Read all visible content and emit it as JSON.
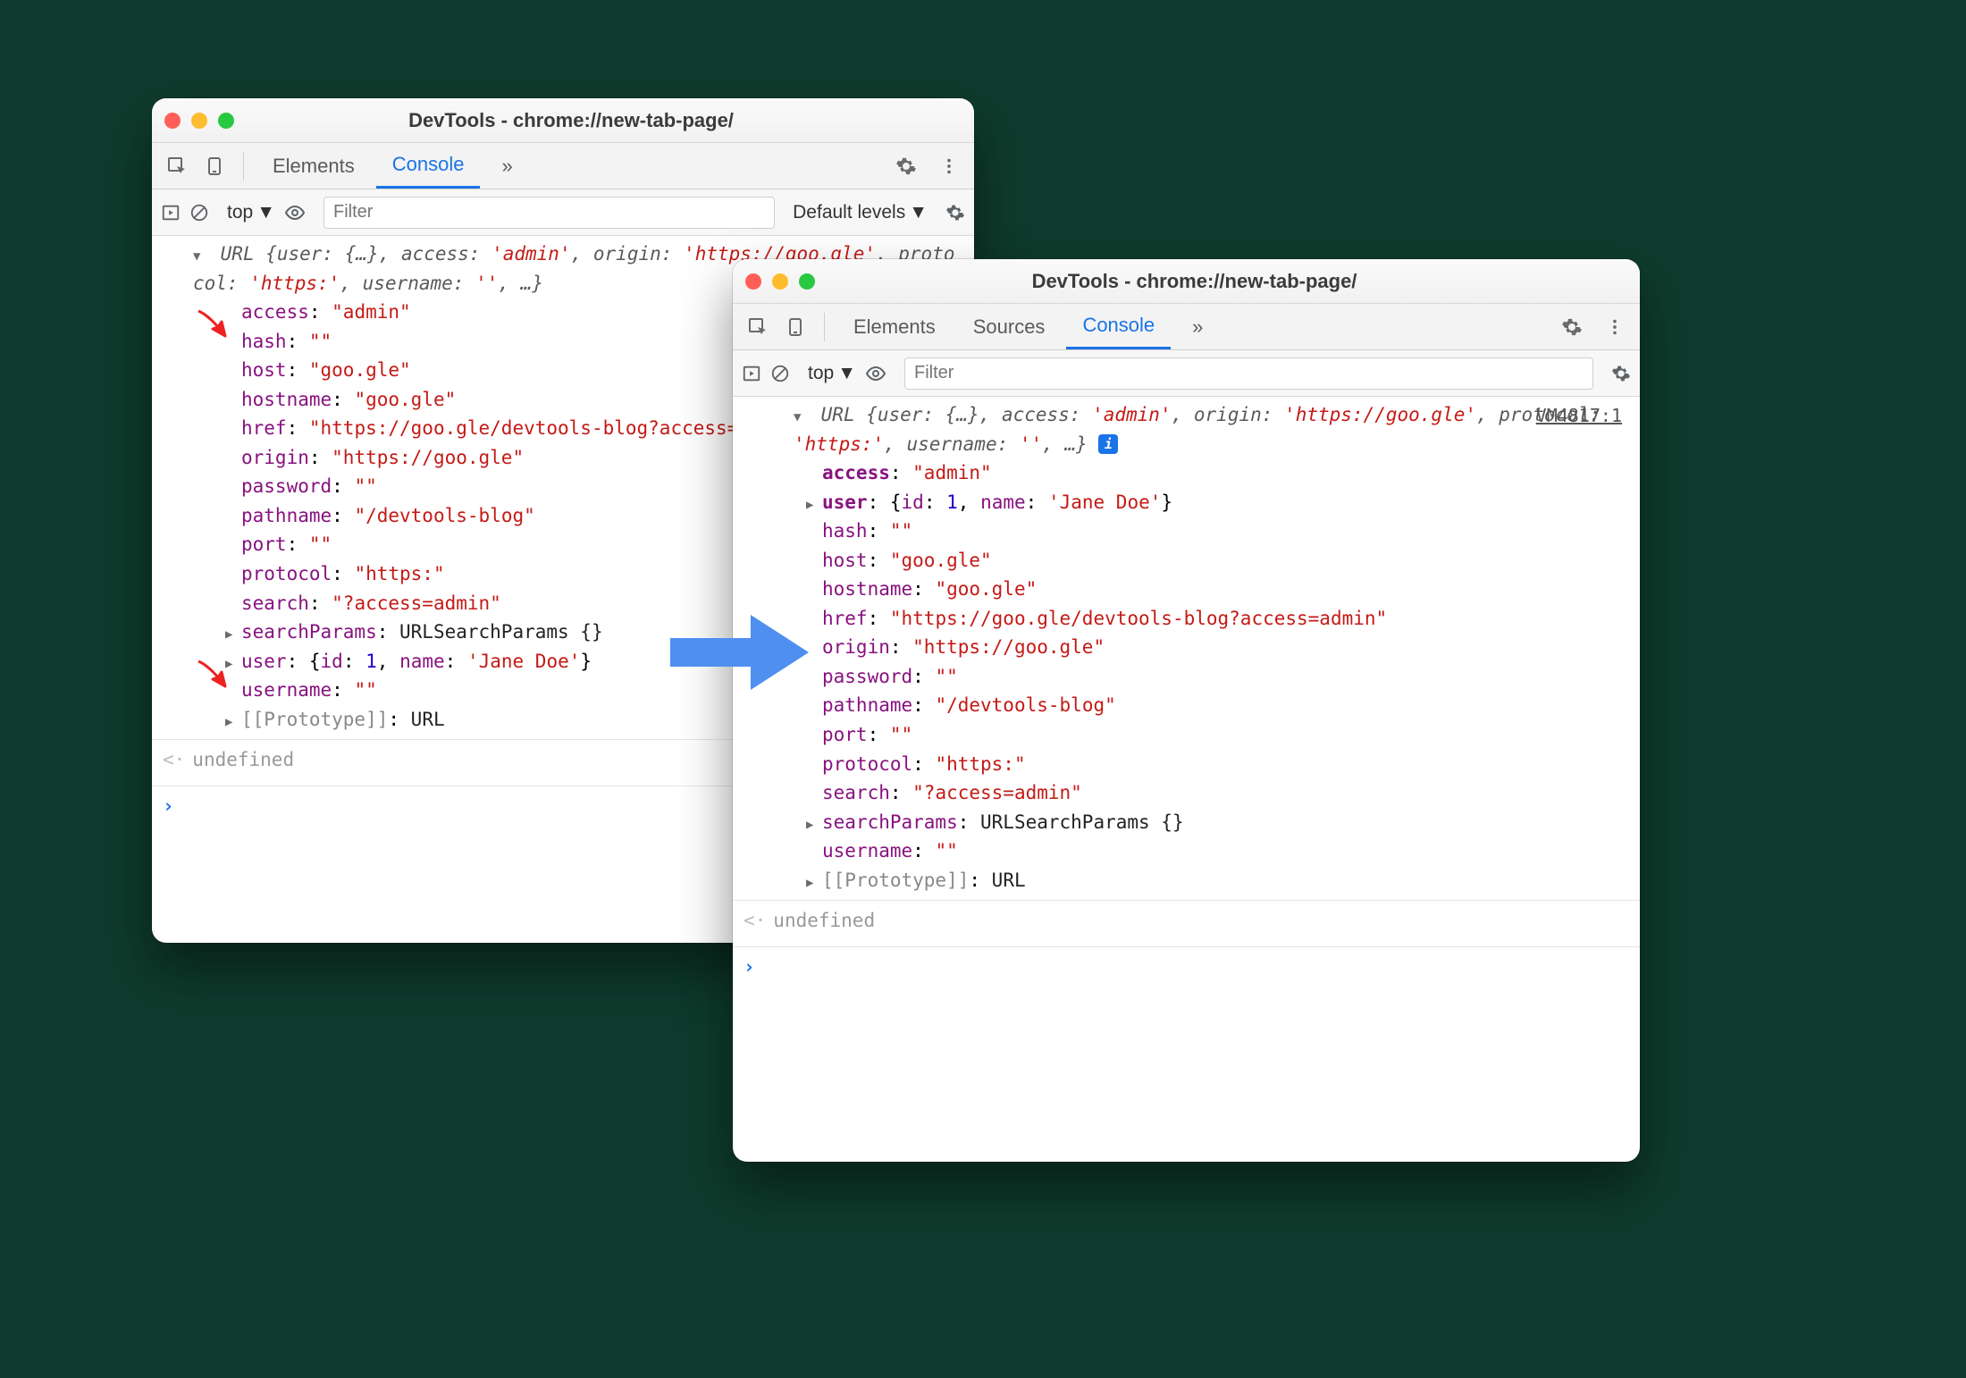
{
  "window1": {
    "title": "DevTools - chrome://new-tab-page/",
    "tabs": {
      "elements": "Elements",
      "console": "Console",
      "more": "»"
    },
    "filterbar": {
      "context": "top",
      "filter_placeholder": "Filter",
      "levels": "Default levels"
    },
    "object_header": "URL {user: {…}, access: 'admin', origin: 'https://goo.gle', protocol: 'https:', username: '', …}",
    "props": {
      "access": {
        "key": "access",
        "val": "\"admin\""
      },
      "hash": {
        "key": "hash",
        "val": "\"\""
      },
      "host": {
        "key": "host",
        "val": "\"goo.gle\""
      },
      "hostname": {
        "key": "hostname",
        "val": "\"goo.gle\""
      },
      "href": {
        "key": "href",
        "val": "\"https://goo.gle/devtools-blog?access=admin\""
      },
      "origin": {
        "key": "origin",
        "val": "\"https://goo.gle\""
      },
      "password": {
        "key": "password",
        "val": "\"\""
      },
      "pathname": {
        "key": "pathname",
        "val": "\"/devtools-blog\""
      },
      "port": {
        "key": "port",
        "val": "\"\""
      },
      "protocol": {
        "key": "protocol",
        "val": "\"https:\""
      },
      "search": {
        "key": "search",
        "val": "\"?access=admin\""
      },
      "searchParams": {
        "key": "searchParams",
        "val": "URLSearchParams {}"
      },
      "user": {
        "key": "user",
        "id_key": "id",
        "id_val": "1",
        "name_key": "name",
        "name_val": "'Jane Doe'"
      },
      "username": {
        "key": "username",
        "val": "\"\""
      },
      "prototype": {
        "key": "[[Prototype]]",
        "val": "URL"
      }
    },
    "undefined": "undefined"
  },
  "window2": {
    "title": "DevTools - chrome://new-tab-page/",
    "tabs": {
      "elements": "Elements",
      "sources": "Sources",
      "console": "Console",
      "more": "»"
    },
    "filterbar": {
      "context": "top",
      "filter_placeholder": "Filter"
    },
    "source_link": "VM4817:1",
    "object_header": "URL {user: {…}, access: 'admin', origin: 'https://goo.gle', protocol: 'https:', username: '', …}",
    "props": {
      "access": {
        "key": "access",
        "val": "\"admin\""
      },
      "user": {
        "key": "user",
        "id_key": "id",
        "id_val": "1",
        "name_key": "name",
        "name_val": "'Jane Doe'"
      },
      "hash": {
        "key": "hash",
        "val": "\"\""
      },
      "host": {
        "key": "host",
        "val": "\"goo.gle\""
      },
      "hostname": {
        "key": "hostname",
        "val": "\"goo.gle\""
      },
      "href": {
        "key": "href",
        "val": "\"https://goo.gle/devtools-blog?access=admin\""
      },
      "origin": {
        "key": "origin",
        "val": "\"https://goo.gle\""
      },
      "password": {
        "key": "password",
        "val": "\"\""
      },
      "pathname": {
        "key": "pathname",
        "val": "\"/devtools-blog\""
      },
      "port": {
        "key": "port",
        "val": "\"\""
      },
      "protocol": {
        "key": "protocol",
        "val": "\"https:\""
      },
      "search": {
        "key": "search",
        "val": "\"?access=admin\""
      },
      "searchParams": {
        "key": "searchParams",
        "val": "URLSearchParams {}"
      },
      "username": {
        "key": "username",
        "val": "\"\""
      },
      "prototype": {
        "key": "[[Prototype]]",
        "val": "URL"
      }
    },
    "undefined": "undefined"
  }
}
